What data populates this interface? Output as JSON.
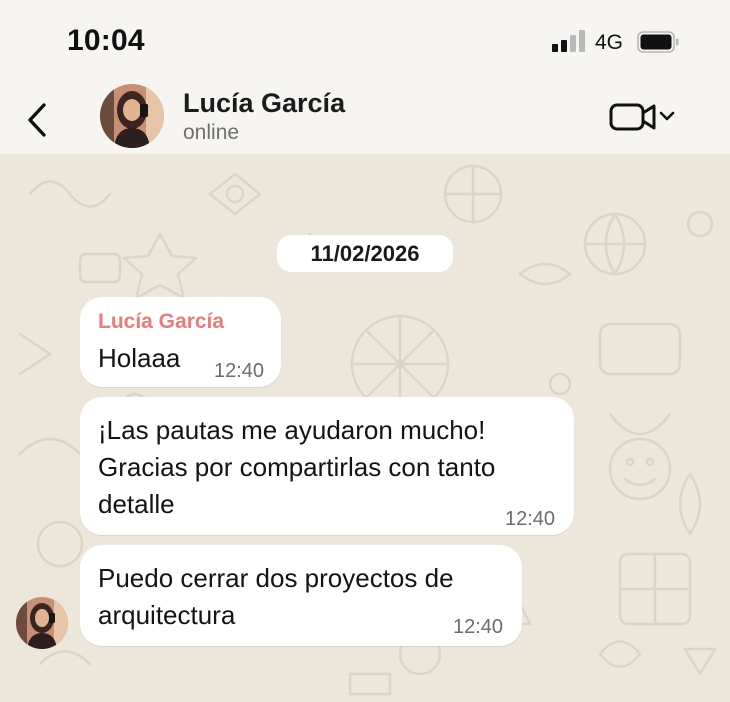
{
  "status_bar": {
    "time": "10:04",
    "network": "4G",
    "signal_icon": "cellular-signal-icon",
    "battery_icon": "battery-icon"
  },
  "header": {
    "back_icon": "chevron-left-icon",
    "contact_name": "Lucía García",
    "contact_status": "online",
    "video_icon": "video-camera-icon",
    "dropdown_icon": "chevron-down-icon"
  },
  "chat": {
    "date": "11/02/2026",
    "messages": [
      {
        "sender": "Lucía García",
        "text": "Holaaa",
        "time": "12:40"
      },
      {
        "text": "¡Las pautas me ayudaron mucho!\nGracias por compartirlas con tanto\ndetalle",
        "time": "12:40"
      },
      {
        "text": "Puedo cerrar dos proyectos de\narquitectura",
        "time": "12:40"
      }
    ]
  },
  "colors": {
    "bar_background": "#f6f5f2",
    "chat_background": "#ece6db",
    "bubble": "#ffffff",
    "sender_name": "#ec7b78",
    "text": "#141414",
    "timestamp": "#6c6c6c"
  }
}
